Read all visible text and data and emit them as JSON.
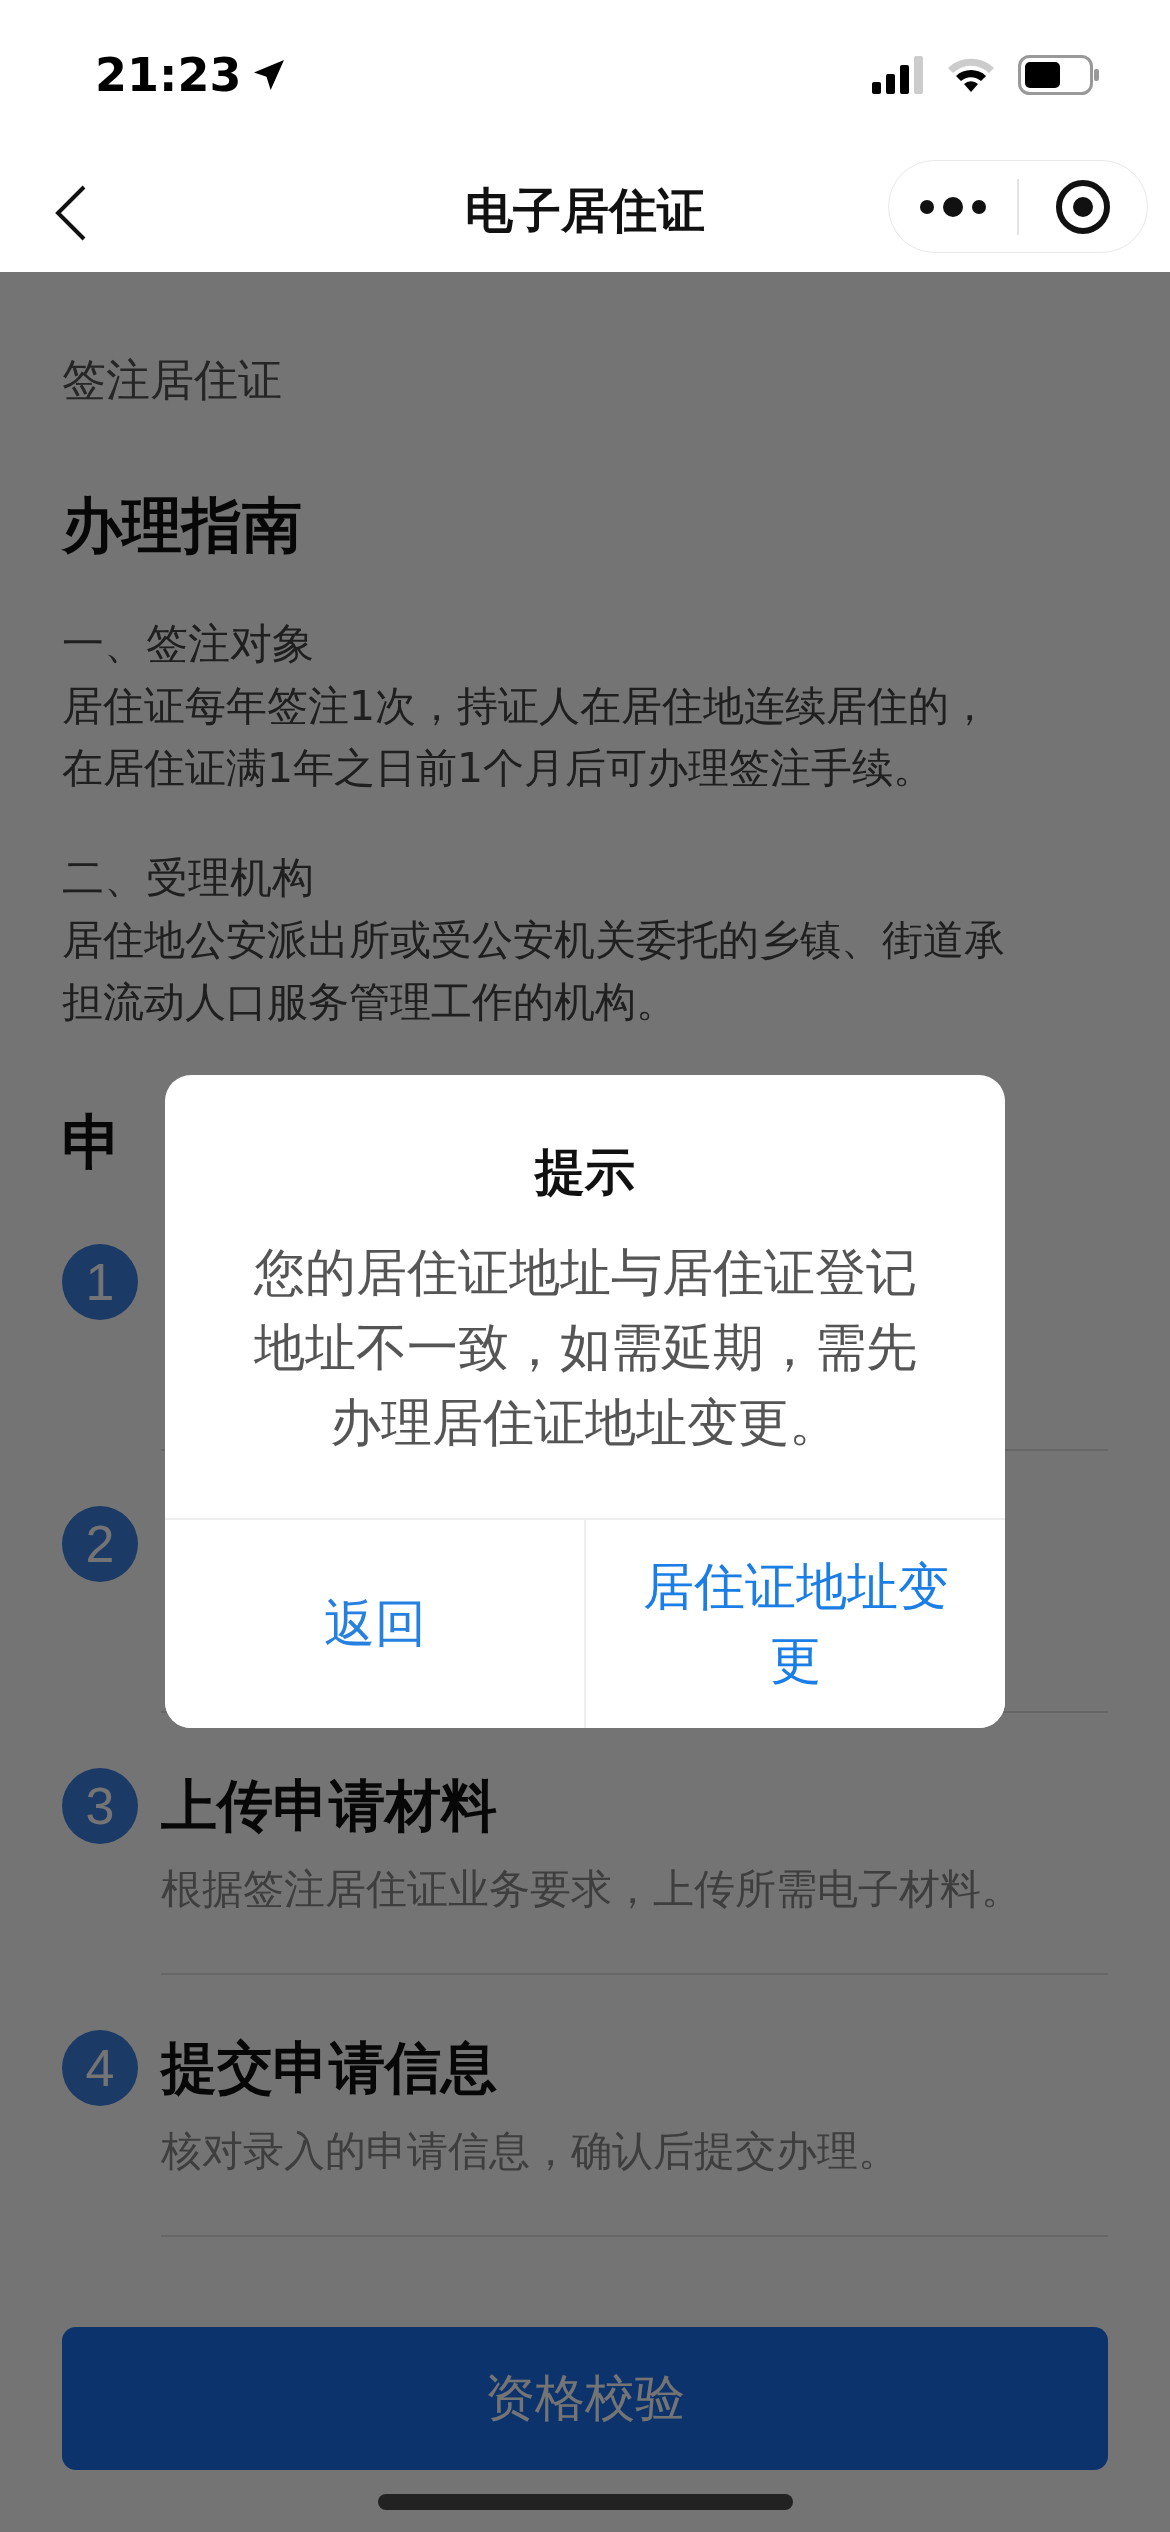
{
  "status_bar": {
    "time": "21:23"
  },
  "nav_bar": {
    "title": "电子居住证"
  },
  "content": {
    "item_value": "签注居住证",
    "guide_title": "办理指南",
    "guide_sections": [
      {
        "heading": "一、签注对象",
        "body": "居住证每年签注1次，持证人在居住地连续居住的，在居住证满1年之日前1个月后可办理签注手续。"
      },
      {
        "heading": "二、受理机构",
        "body": "居住地公安派出所或受公安机关委托的乡镇、街道承担流动人口服务管理工作的机构。"
      }
    ],
    "process_title": "申",
    "steps": [
      {
        "number": "1"
      },
      {
        "number": "2"
      },
      {
        "number": "3",
        "title": "上传申请材料",
        "description": "根据签注居住证业务要求，上传所需电子材料。"
      },
      {
        "number": "4",
        "title": "提交申请信息",
        "description": "核对录入的申请信息，确认后提交办理。"
      }
    ]
  },
  "primary_button": "资格校验",
  "dialog": {
    "title": "提示",
    "message": "您的居住证地址与居住证登记地址不一致，如需延期，需先办理居住证地址变更。",
    "buttons": [
      {
        "label": "返回",
        "kind": "cancel"
      },
      {
        "label": "居住证地址变更",
        "kind": "confirm"
      }
    ]
  }
}
